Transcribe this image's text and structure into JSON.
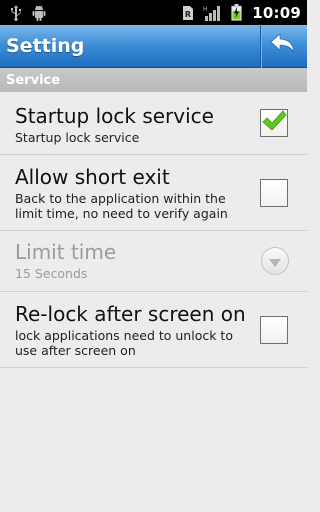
{
  "status_bar": {
    "time": "10:09",
    "icons": [
      "usb-icon",
      "android-debug-icon",
      "sim-card-icon",
      "signal-strength-icon",
      "battery-charging-icon"
    ]
  },
  "header": {
    "title": "Setting",
    "back_icon": "back-arrow-icon"
  },
  "section": {
    "title": "Service"
  },
  "preferences": [
    {
      "title": "Startup lock service",
      "summary": "Startup lock service",
      "widget": "checkbox",
      "checked": true,
      "enabled": true
    },
    {
      "title": "Allow short exit",
      "summary": "Back to the application within the limit time, no need to verify again",
      "widget": "checkbox",
      "checked": false,
      "enabled": true
    },
    {
      "title": "Limit time",
      "summary": "15 Seconds",
      "widget": "dropdown",
      "enabled": false
    },
    {
      "title": "Re-lock after screen on",
      "summary": "lock applications need to unlock to use after screen on",
      "widget": "checkbox",
      "checked": false,
      "enabled": true
    }
  ],
  "colors": {
    "title_bar": "#3f8fd8",
    "checkmark": "#5fc81e",
    "section_header": "#bfbfbf",
    "background": "#ececec"
  }
}
